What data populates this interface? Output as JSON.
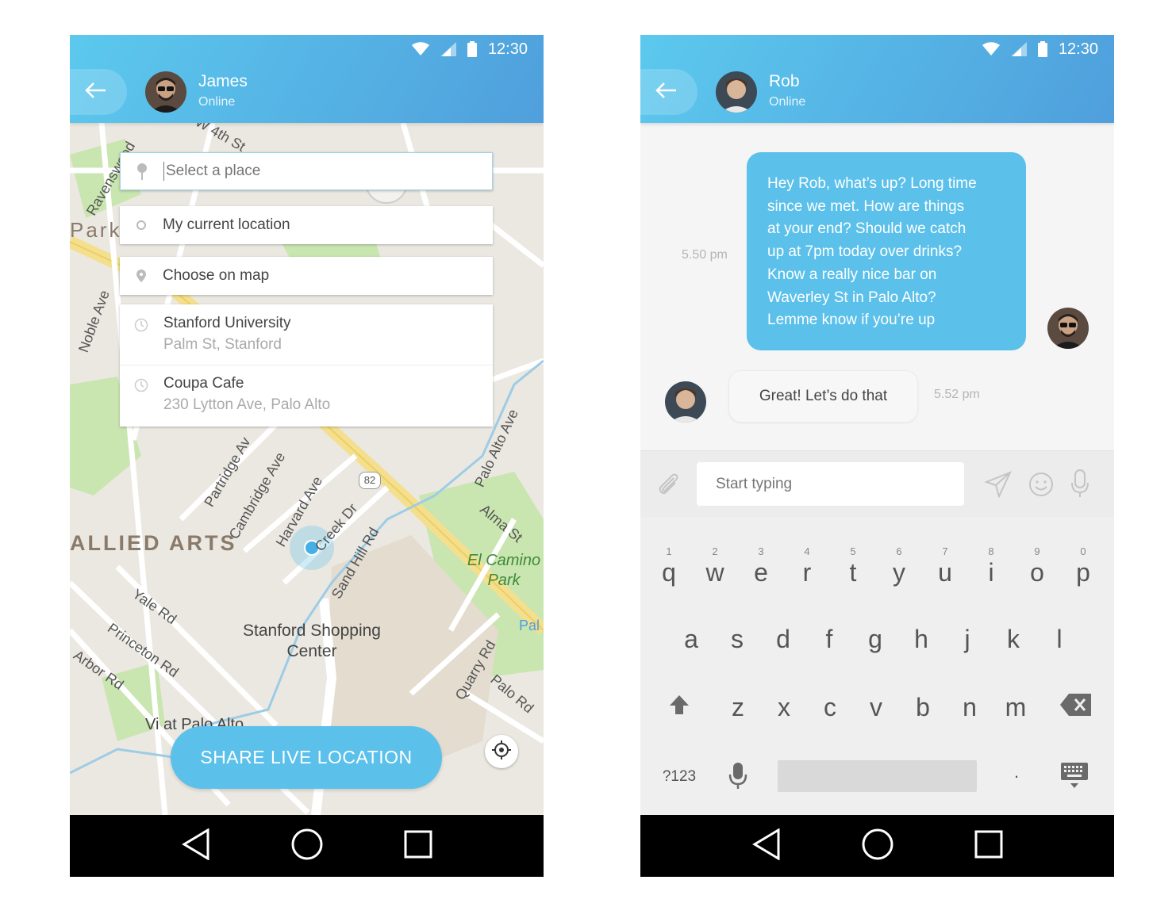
{
  "left_screen": {
    "status": {
      "time": "12:30"
    },
    "contact": {
      "name": "James",
      "status": "Online"
    },
    "search": {
      "placeholder": "Select a place"
    },
    "options": {
      "current_location": "My current location",
      "choose_on_map": "Choose on map"
    },
    "suggestions": [
      {
        "title": "Stanford University",
        "subtitle": "Palm St, Stanford"
      },
      {
        "title": "Coupa Cafe",
        "subtitle": "230 Lytton Ave, Palo Alto"
      }
    ],
    "map_labels": {
      "allied_arts": "ALLIED ARTS",
      "el_camino_park": "El Camino Park",
      "stanford_shopping": "Stanford Shopping Center",
      "yale_rd": "Yale Rd",
      "princeton_rd": "Princeton Rd",
      "arbor_rd": "Arbor Rd",
      "partridge": "Partridge Av",
      "cambridge": "Cambridge Ave",
      "harvard": "Harvard Ave",
      "sand_hill": "Sand Hill Rd",
      "palo_alto_ave": "Palo Alto Ave",
      "alma": "Alma St",
      "quarry": "Quarry Rd",
      "palo_rd": "Palo Rd",
      "creek": "Creek Dr",
      "ravenswood": "Ravenswood",
      "noble": "Noble Ave",
      "w4th": "W 4th St",
      "park": "Park",
      "hwy82": "82",
      "vi": "Vi at Palo Alto",
      "pal": "Pal"
    },
    "share_button": "SHARE LIVE LOCATION"
  },
  "right_screen": {
    "status": {
      "time": "12:30"
    },
    "contact": {
      "name": "Rob",
      "status": "Online"
    },
    "messages": [
      {
        "direction": "outgoing",
        "time": "5.50 pm",
        "lines": [
          "Hey Rob, what’s up? Long time",
          "since we met. How are things",
          "at your end? Should we catch",
          "up at 7pm today over drinks?",
          "Know a really nice bar on",
          "Waverley St in Palo Alto?",
          "Lemme know if you’re up"
        ]
      },
      {
        "direction": "incoming",
        "time": "5.52 pm",
        "text": "Great! Let’s do that"
      }
    ],
    "composer": {
      "placeholder": "Start typing"
    },
    "keyboard": {
      "row1": [
        {
          "k": "q",
          "n": "1"
        },
        {
          "k": "w",
          "n": "2"
        },
        {
          "k": "e",
          "n": "3"
        },
        {
          "k": "r",
          "n": "4"
        },
        {
          "k": "t",
          "n": "5"
        },
        {
          "k": "y",
          "n": "6"
        },
        {
          "k": "u",
          "n": "7"
        },
        {
          "k": "i",
          "n": "8"
        },
        {
          "k": "o",
          "n": "9"
        },
        {
          "k": "p",
          "n": "0"
        }
      ],
      "row2": [
        "a",
        "s",
        "d",
        "f",
        "g",
        "h",
        "j",
        "k",
        "l"
      ],
      "row3": [
        "z",
        "x",
        "c",
        "v",
        "b",
        "n",
        "m"
      ],
      "symbols": "?123",
      "period": "."
    }
  },
  "colors": {
    "accent": "#5bc0ea",
    "header_start": "#5cc9ee",
    "header_end": "#4f9fdc"
  }
}
